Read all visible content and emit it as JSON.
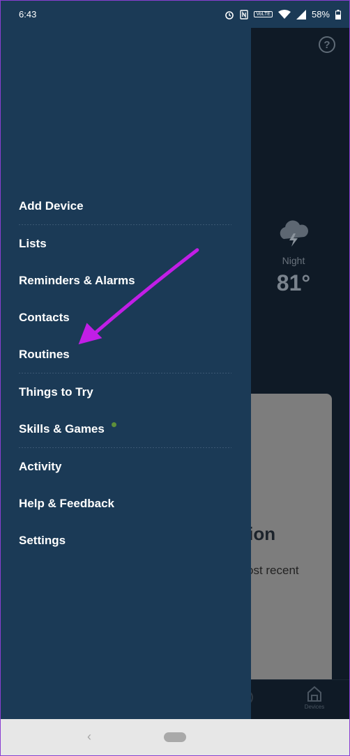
{
  "status_bar": {
    "time": "6:43",
    "volte": "VoLTE",
    "battery": "58%"
  },
  "background": {
    "help_symbol": "?",
    "weather": {
      "label": "Night",
      "temp": "81°"
    },
    "card": {
      "title_fragment": "ation",
      "text_fragment": "ost recent"
    },
    "bottom_nav": {
      "devices_label": "Devices"
    }
  },
  "drawer": {
    "items": [
      {
        "label": "Add Device"
      },
      {
        "label": "Lists"
      },
      {
        "label": "Reminders & Alarms"
      },
      {
        "label": "Contacts"
      },
      {
        "label": "Routines"
      },
      {
        "label": "Things to Try"
      },
      {
        "label": "Skills & Games"
      },
      {
        "label": "Activity"
      },
      {
        "label": "Help & Feedback"
      },
      {
        "label": "Settings"
      }
    ]
  },
  "colors": {
    "drawer_bg": "#1b3a56",
    "arrow": "#c11ee6",
    "new_dot": "#5e8f3a"
  },
  "icons": [
    "alarm-icon",
    "nfc-icon",
    "wifi-icon",
    "signal-icon",
    "battery-icon",
    "help-icon",
    "storm-cloud-icon",
    "back-icon",
    "home-icon"
  ]
}
